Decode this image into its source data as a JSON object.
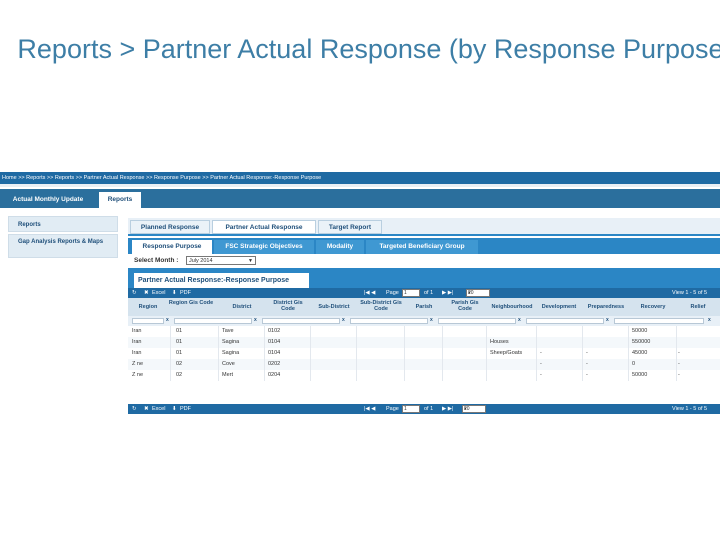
{
  "slide": {
    "title": "Reports > Partner Actual Response (by Response Purpose)"
  },
  "breadcrumb": "Home >> Reports >> Reports >> Partner Actual Response >> Response Purpose >> Partner Actual Response:-Response Purpose",
  "topnav": {
    "tabs": [
      {
        "label": "Actual Monthly Update",
        "active": false
      },
      {
        "label": "Reports",
        "active": true
      }
    ]
  },
  "sidebar": {
    "items": [
      {
        "label": "Reports"
      },
      {
        "label": "Gap Analysis Reports & Maps"
      }
    ]
  },
  "report_tabs": [
    {
      "label": "Planned Response",
      "active": false
    },
    {
      "label": "Partner Actual Response",
      "active": true
    },
    {
      "label": "Target Report",
      "active": false
    }
  ],
  "sub_tabs": [
    {
      "label": "Response Purpose",
      "active": true
    },
    {
      "label": "FSC Strategic Objectives",
      "active": false
    },
    {
      "label": "Modality",
      "active": false
    },
    {
      "label": "Targeted Beneficiary Group",
      "active": false
    }
  ],
  "filters": {
    "month_label": "Select Month :",
    "month_value": "July 2014"
  },
  "panel": {
    "title": "Partner Actual Response:-Response Purpose"
  },
  "pager_top": {
    "refresh": "↻",
    "excel": "Excel",
    "pdf": "PDF",
    "page_label": "Page",
    "page_value": "1",
    "of": "of 1",
    "rows": "20",
    "view": "View 1 - 5 of 5"
  },
  "pager_bottom": {
    "refresh": "↻",
    "excel": "Excel",
    "pdf": "PDF",
    "page_label": "Page",
    "page_value": "1",
    "of": "of 1",
    "rows": "20",
    "view": "View 1 - 5 of 5"
  },
  "grid": {
    "columns": [
      "Region",
      "Region Gis Code",
      "District",
      "District Gis Code",
      "Sub-District",
      "Sub-District Gis Code",
      "Parish",
      "Parish Gis Code",
      "Neighbourhood",
      "Development",
      "Preparedness",
      "Recovery",
      "Relief"
    ],
    "filter_clear": "x",
    "rows": [
      [
        "Iran",
        "01",
        "Tave",
        "0102",
        "",
        "",
        "",
        "",
        "",
        "",
        "",
        "50000",
        ""
      ],
      [
        "Iran",
        "01",
        "Sagina",
        "0104",
        "",
        "",
        "",
        "",
        "Houses",
        "",
        "",
        "550000",
        ""
      ],
      [
        "Iran",
        "01",
        "Sagina",
        "0104",
        "",
        "",
        "",
        "",
        "Sheep/Goats",
        "-",
        "-",
        "45000",
        "-"
      ],
      [
        "Z ne",
        "02",
        "Cove",
        "0202",
        "",
        "",
        "",
        "",
        "",
        "-",
        "-",
        "0",
        "-"
      ],
      [
        "Z ne",
        "02",
        "Mert",
        "0204",
        "",
        "",
        "",
        "",
        "",
        "-",
        "-",
        "50000",
        "-"
      ]
    ]
  }
}
